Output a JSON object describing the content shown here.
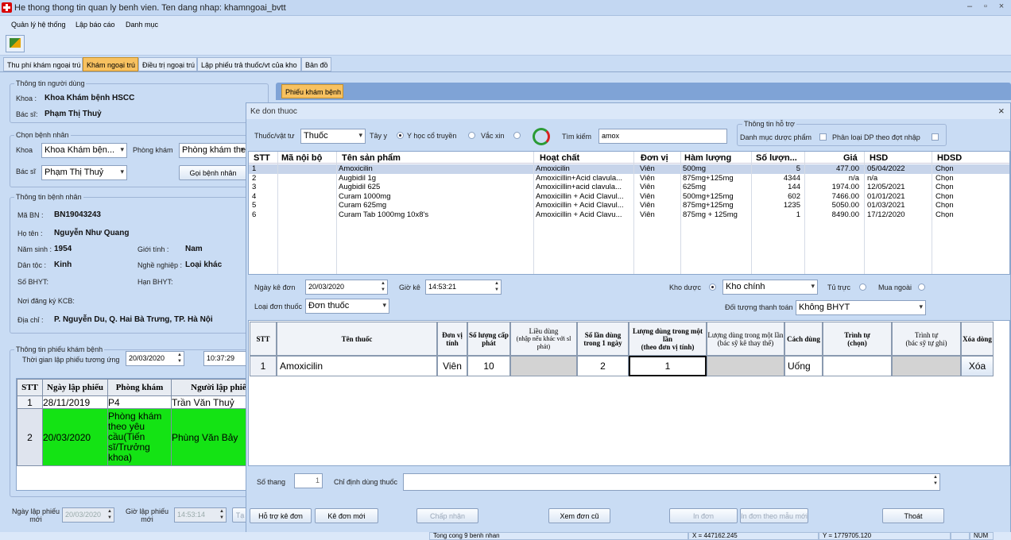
{
  "window": {
    "title": "He thong thong tin quan ly benh vien. Ten dang nhap: khamngoai_bvtt",
    "min": "–",
    "max": "▫",
    "close": "×"
  },
  "menu": [
    "Quản lý hệ thống",
    "Lập báo cáo",
    "Danh mục"
  ],
  "tabs": [
    "Thu phí khám ngoại trú",
    "Khám ngoại trú",
    "Điều trị ngoại trú",
    "Lập phiếu trả thuốc/vt của kho",
    "Bản đồ"
  ],
  "user": {
    "group": "Thông tin người dùng",
    "khoa_label": "Khoa :",
    "khoa": "Khoa Khám bệnh  HSCC",
    "bacsi_label": "Bác sĩ:",
    "bacsi": "Phạm Thị Thuỷ"
  },
  "chon": {
    "group": "Chọn bệnh nhân",
    "khoa_label": "Khoa",
    "khoa": "Khoa Khám bện...",
    "pk_label": "Phòng khám",
    "pk": "Phòng khám the",
    "bs_label": "Bác sĩ",
    "bs": "Phạm Thị Thuỷ",
    "goi": "Gọi bệnh nhân"
  },
  "bn": {
    "group": "Thông tin bệnh nhân",
    "mabn_label": "Mã BN :",
    "mabn": "BN19043243",
    "hoten_label": "Họ tên :",
    "hoten": "Nguyễn Như Quang",
    "ns_label": "Năm sinh :",
    "ns": "1954",
    "gt_label": "Giới tính :",
    "gt": "Nam",
    "dt_label": "Dân tộc :",
    "dt": "Kinh",
    "nn_label": "Nghề nghiệp :",
    "nn": "Loại khác",
    "bhyt_label": "Số BHYT:",
    "han_label": "Hạn BHYT:",
    "kcb_label": "Nơi đăng ký KCB:",
    "dc_label": "Địa chỉ :",
    "dc": "P. Nguyễn Du, Q. Hai Bà Trưng, TP. Hà Nội"
  },
  "phieu": {
    "group": "Thông tin phiếu khám bệnh",
    "tg_label": "Thời gian lập phiếu tương ứng",
    "date": "20/03/2020",
    "time": "10:37:29",
    "headers": [
      "STT",
      "Ngày lập phiếu",
      "Phòng khám",
      "Người lập phiếu"
    ],
    "rows": [
      [
        "1",
        "28/11/2019",
        "P4",
        "Trần Văn Thuỷ"
      ],
      [
        "2",
        "20/03/2020",
        "Phòng khám theo yêu cầu(Tiến sĩ/Trưởng khoa)",
        "Phùng Văn Bảy"
      ]
    ],
    "nlp_label": "Ngày lập phiếu mới",
    "nlp": "20/03/2020",
    "glp_label": "Giờ lập phiếu mới",
    "glp": "14:53:14",
    "ta": "Tạ"
  },
  "pkb_tab": "Phiếu khám bệnh",
  "dialog": {
    "title": "Ke don thuoc",
    "close": "×",
    "tvt_label": "Thuốc/vật tư",
    "tvt": "Thuốc",
    "tayy": "Tây y",
    "yhct": "Y học cổ truyền",
    "vacxin": "Vắc xin",
    "tk_label": "Tìm kiếm",
    "tk": "amox",
    "hotro": {
      "group": "Thông tin hỗ trợ",
      "dm": "Danh mục dược phẩm",
      "pl": "Phân loại DP theo đợt nhập"
    },
    "grid_headers": [
      "STT",
      "Mã nội bộ",
      "Tên sản phẩm",
      "Hoạt chất",
      "Đơn vị",
      "Hàm lượng",
      "Số lượn...",
      "Giá",
      "HSD",
      "HDSD"
    ],
    "products": [
      [
        "1",
        "",
        "Amoxicilin",
        "Amoxicilin",
        "Viên",
        "500mg",
        "5",
        "477.00",
        "05/04/2022",
        "Chọn"
      ],
      [
        "2",
        "",
        "Augbidil 1g",
        "Amoxicillin+Acid clavula...",
        "Viên",
        "875mg+125mg",
        "4344",
        "n/a",
        "n/a",
        "Chọn"
      ],
      [
        "3",
        "",
        "Augbidil 625",
        "Amoxicillin+acid clavula...",
        "Viên",
        "625mg",
        "144",
        "1974.00",
        "12/05/2021",
        "Chọn"
      ],
      [
        "4",
        "",
        "Curam 1000mg",
        "Amoxicillin + Acid Clavul...",
        "Viên",
        "500mg+125mg",
        "602",
        "7466.00",
        "01/01/2021",
        "Chọn"
      ],
      [
        "5",
        "",
        "Curam 625mg",
        "Amoxicillin + Acid Clavul...",
        "Viên",
        "875mg+125mg",
        "1235",
        "5050.00",
        "01/03/2021",
        "Chọn"
      ],
      [
        "6",
        "",
        "Curam Tab 1000mg 10x8's",
        "Amoxicillin + Acid Clavu...",
        "Viên",
        "875mg + 125mg",
        "1",
        "8490.00",
        "17/12/2020",
        "Chọn"
      ]
    ],
    "nkd_label": "Ngày kê đơn",
    "nkd": "20/03/2020",
    "gk_label": "Giờ kê",
    "gk": "14:53:21",
    "kho_label": "Kho dược",
    "kho": "Kho chính",
    "tutruc": "Tủ trực",
    "muangoai": "Mua ngoài",
    "ldt_label": "Loại đơn thuốc",
    "ldt": "Đơn thuốc",
    "dttt_label": "Đối tượng thanh toán",
    "dttt": "Không BHYT",
    "rx_headers": [
      "STT",
      "Tên thuốc",
      "Đơn vị tính",
      "Số lượng cấp phát",
      "Liều dùng",
      "(nhập nếu khác với sl phát)",
      "Số lần dùng trong 1 ngày",
      "Lượng dùng trong một lần",
      "(theo đơn vị tính)",
      "Lượng dùng trong một lần",
      "(bác sỹ kê thay thế)",
      "Cách dùng",
      "Trình tự",
      "(chọn)",
      "Trình tự",
      "(bác sỹ tự ghi)",
      "Xóa dòng"
    ],
    "rx": {
      "stt": "1",
      "ten": "Amoxicilin",
      "dvt": "Viên",
      "sl": "10",
      "solan": "2",
      "luong": "1",
      "cach": "Uống",
      "xoa": "Xóa"
    },
    "sothang_label": "Số thang",
    "sothang": "1",
    "cd_label": "Chỉ định dùng thuốc",
    "buttons": [
      "Hỗ trợ kê đơn",
      "Kê đơn mới",
      "Chấp nhận",
      "Xem đơn cũ",
      "In đơn",
      "In đơn theo mẫu mới",
      "Thoát"
    ]
  },
  "status": {
    "total": "Tong cong 9 benh nhan",
    "x": "X = 447162.245",
    "y": "Y = 1779705.120",
    "num": "NUM"
  }
}
